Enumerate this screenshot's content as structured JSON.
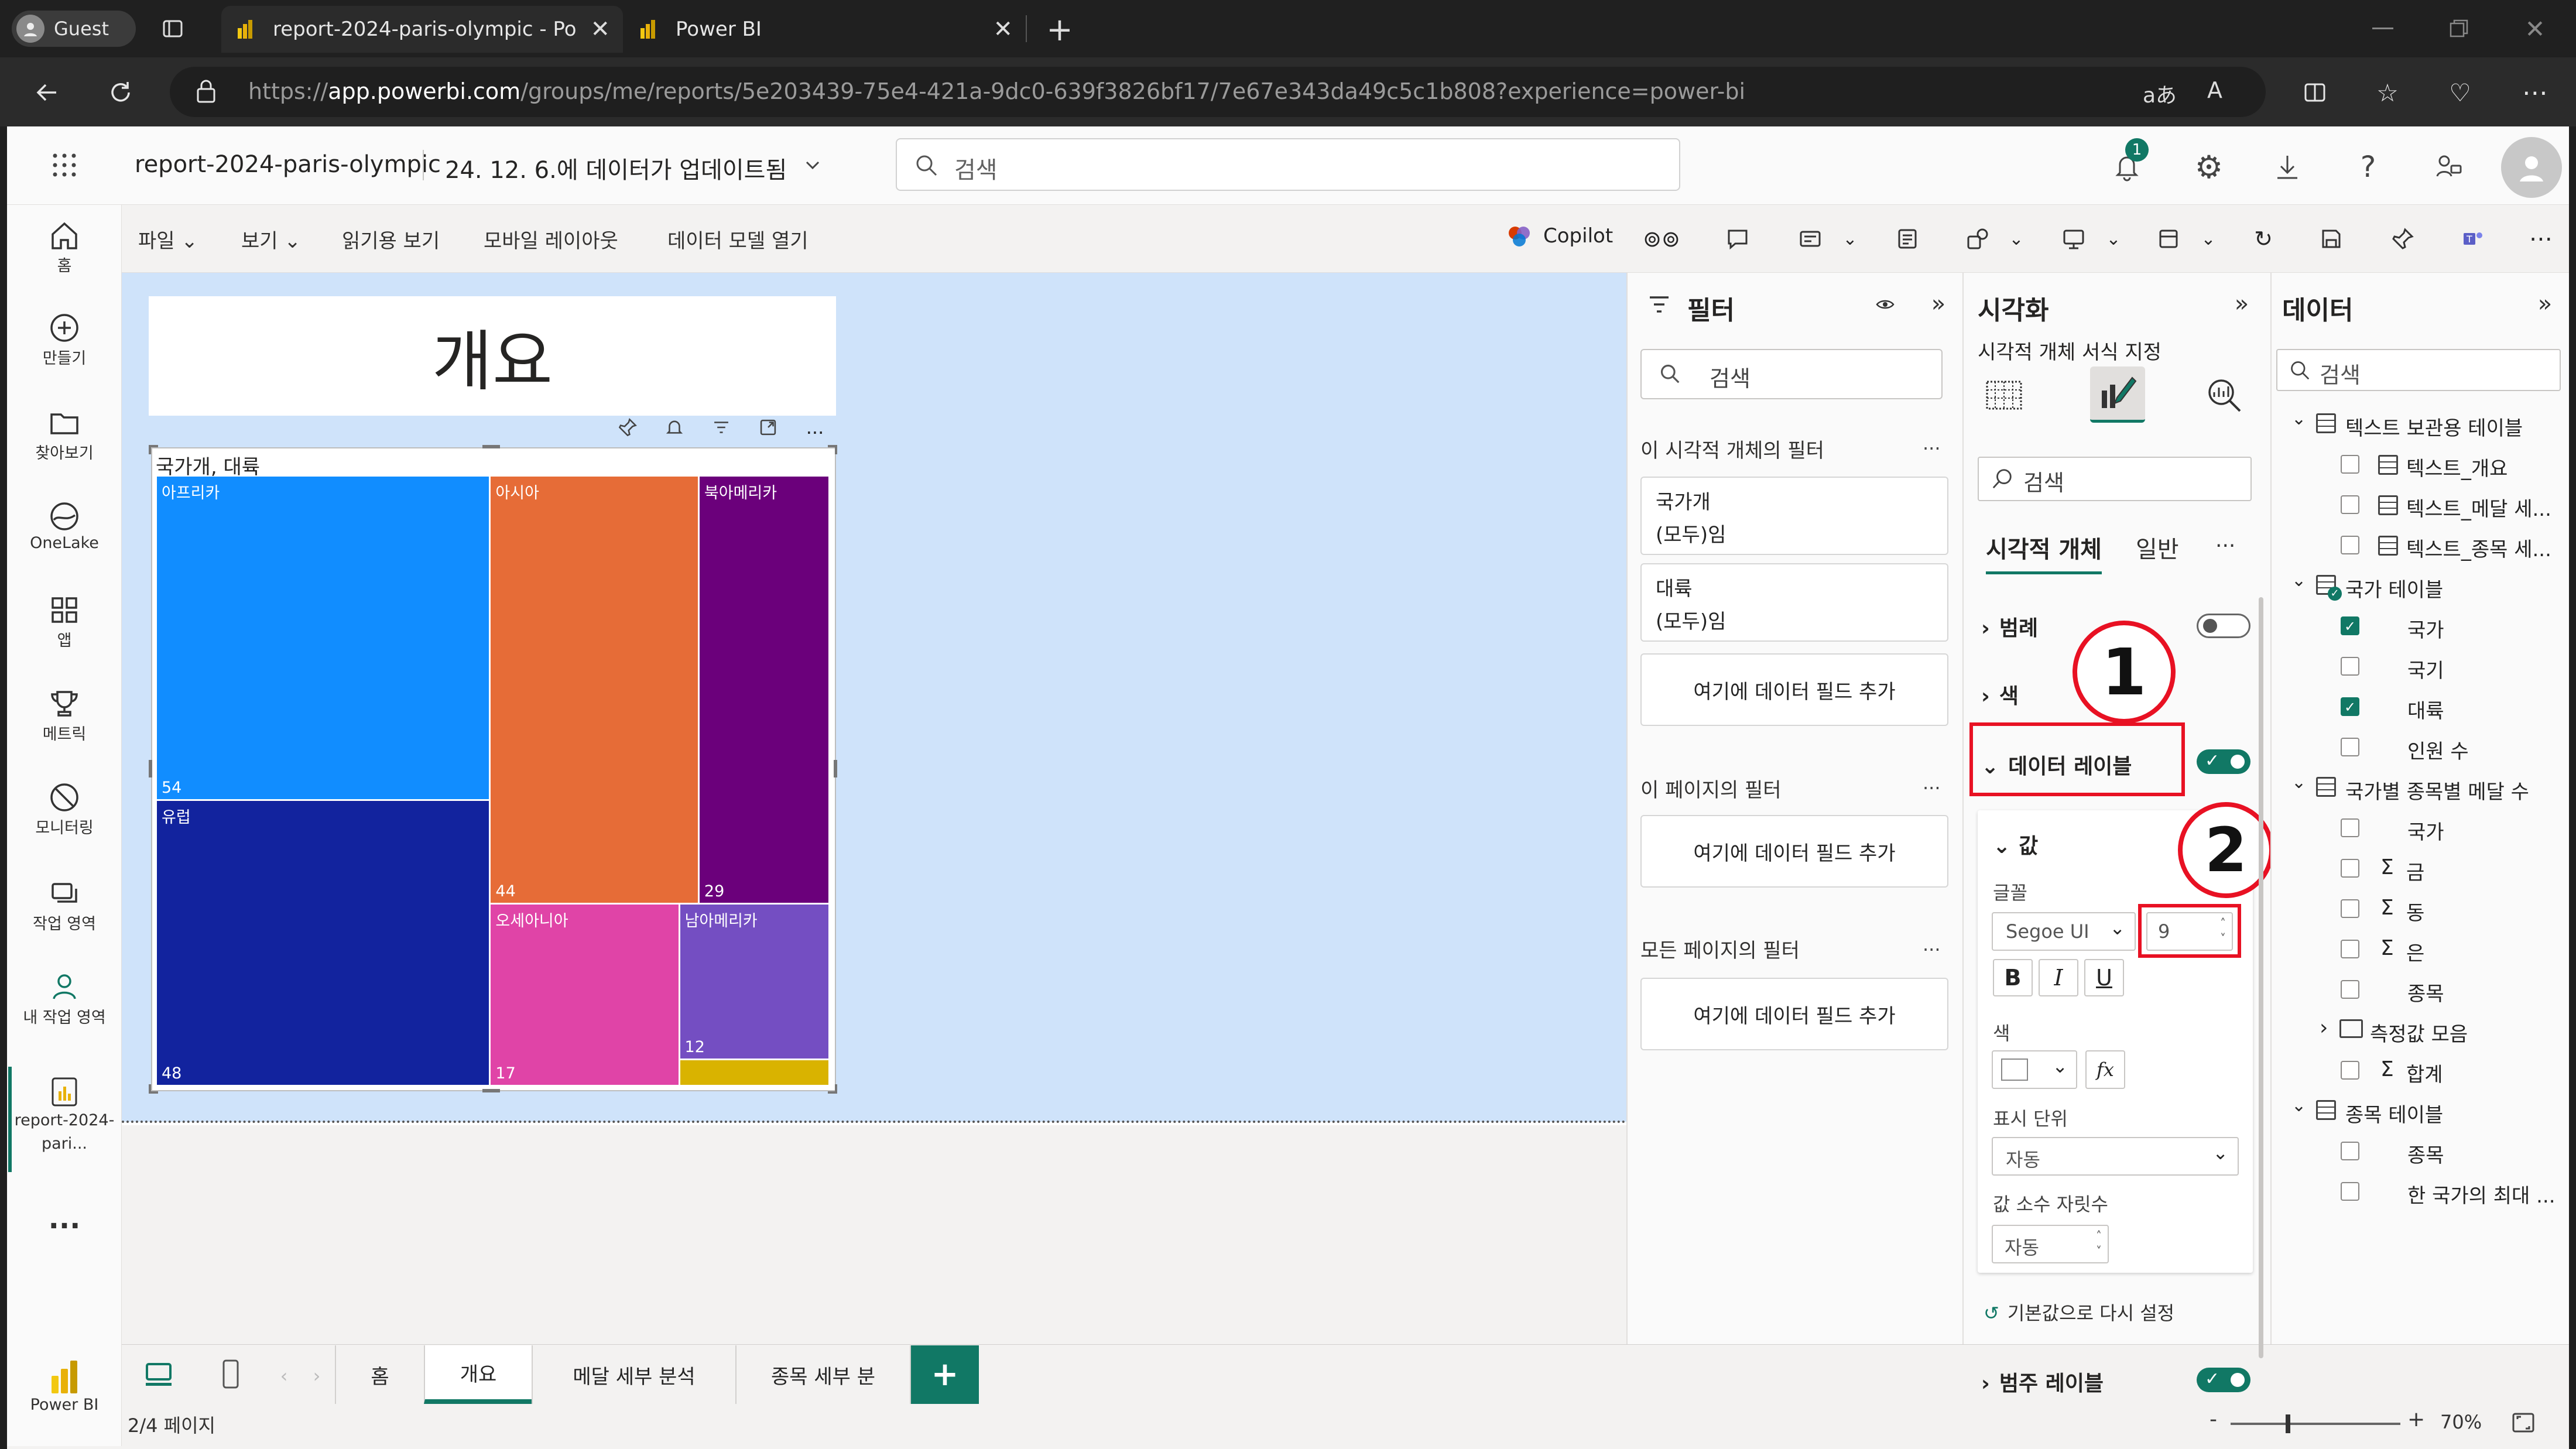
{
  "browser": {
    "profile": "Guest",
    "tabs": [
      {
        "title": "report-2024-paris-olympic - Pow"
      },
      {
        "title": "Power BI"
      }
    ],
    "url_prefix": "https://",
    "url_host": "app.powerbi.com",
    "url_path": "/groups/me/reports/5e203439-75e4-421a-9dc0-639f3826bf17/7e67e343da49c5c1b808?experience=power-bi",
    "read_aloud": "aあ"
  },
  "header": {
    "report_name": "report-2024-paris-olympic",
    "updated": "24. 12. 6.에 데이터가 업데이트됨",
    "search_placeholder": "검색",
    "notif_count": "1"
  },
  "nav": {
    "items": [
      "홈",
      "만들기",
      "찾아보기",
      "OneLake",
      "앱",
      "메트릭",
      "모니터링",
      "작업 영역",
      "내 작업 영역"
    ],
    "current_report": "report-2024-pari...",
    "more": "...",
    "brand": "Power BI"
  },
  "ribbon": {
    "menus": [
      "파일",
      "보기",
      "읽기용 보기",
      "모바일 레이아웃",
      "데이터 모델 열기"
    ],
    "copilot": "Copilot"
  },
  "report": {
    "title": "개요",
    "visual_header": "국가개, 대륙",
    "visual_toolbar_more": "...",
    "treemap": [
      {
        "name": "아프리카",
        "value": 54,
        "color": "#118dff"
      },
      {
        "name": "유럽",
        "value": 48,
        "color": "#12239e"
      },
      {
        "name": "아시아",
        "value": 44,
        "color": "#e66c37"
      },
      {
        "name": "북아메리카",
        "value": 29,
        "color": "#6b007b"
      },
      {
        "name": "오세아니아",
        "value": 17,
        "color": "#e044a7"
      },
      {
        "name": "남아메리카",
        "value": 12,
        "color": "#744ec2"
      },
      {
        "name": "",
        "value": null,
        "color": "#d9b300"
      }
    ]
  },
  "pages": {
    "tabs": [
      "홈",
      "개요",
      "메달 세부 분석",
      "종목 세부 분"
    ],
    "add": "+",
    "active": "개요",
    "status": "2/4 페이지",
    "zoom": "70%"
  },
  "filters": {
    "title": "필터",
    "search": "검색",
    "visual_section": "이 시각적 개체의 필터",
    "f1_name": "국가개",
    "f1_value": "(모두)임",
    "f2_name": "대륙",
    "f2_value": "(모두)임",
    "add_field": "여기에 데이터 필드 추가",
    "page_section": "이 페이지의 필터",
    "all_section": "모든 페이지의 필터",
    "more": "..."
  },
  "viz": {
    "title": "시각화",
    "subtitle": "시각적 개체 서식 지정",
    "search": "검색",
    "tab_visual": "시각적 개체",
    "tab_general": "일반",
    "more": "...",
    "legend": "범례",
    "color": "색",
    "data_labels": "데이터 레이블",
    "values": "값",
    "font_label": "글꼴",
    "font_family": "Segoe UI",
    "font_size": "9",
    "bold": "B",
    "italic": "I",
    "underline": "U",
    "color_label": "색",
    "fx": "fx",
    "display_units_label": "표시 단위",
    "display_units": "자동",
    "decimals_label": "값 소수 자릿수",
    "decimals": "자동",
    "reset": "기본값으로 다시 설정",
    "category_labels": "범주 레이블",
    "callout1": "1",
    "callout2": "2"
  },
  "data": {
    "title": "데이터",
    "search": "검색",
    "tables": [
      {
        "name": "텍스트 보관용 테이블",
        "fields": [
          "텍스트_개요",
          "텍스트_메달 세...",
          "텍스트_종목 세..."
        ]
      },
      {
        "name": "국가 테이블",
        "fields": [
          "국가",
          "국기",
          "대륙",
          "인원 수"
        ]
      },
      {
        "name": "국가별 종목별 메달 수",
        "fields": [
          "국가",
          "금",
          "동",
          "은",
          "종목"
        ],
        "folder": "측정값 모음",
        "after": [
          "합계"
        ]
      },
      {
        "name": "종목 테이블",
        "fields": [
          "종목",
          "한 국가의 최대 ..."
        ]
      }
    ]
  },
  "colors": {
    "accent": "#117865",
    "callout": "#e81123"
  }
}
